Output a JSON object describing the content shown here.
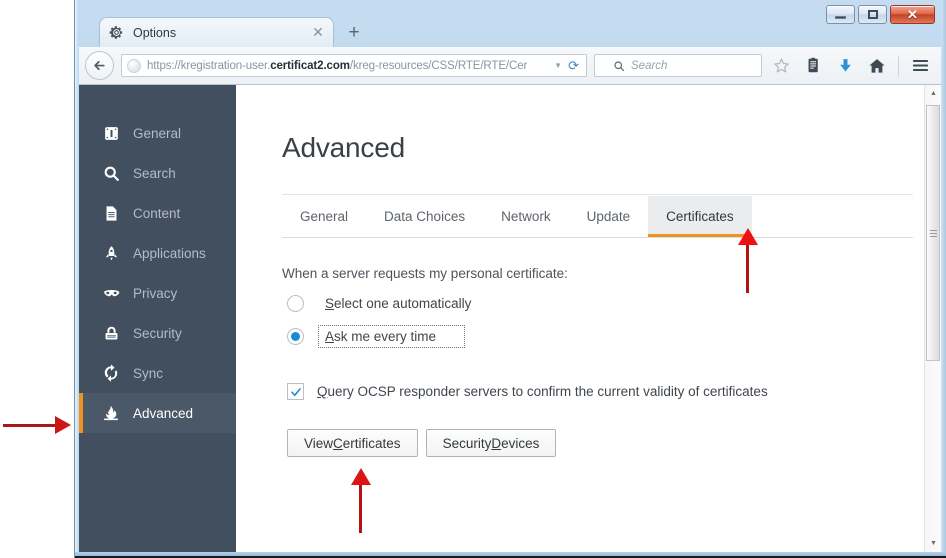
{
  "window": {
    "minimize_label": "Minimize",
    "maximize_label": "Maximize",
    "close_label": "✕"
  },
  "browser": {
    "tab": {
      "icon": "gear-icon",
      "title": "Options",
      "close_label": "✕"
    },
    "new_tab_label": "+",
    "back_label": "Back",
    "url": {
      "prefix": "https://kregistration-user.",
      "domain": "certificat2.com",
      "suffix": "/kreg-resources/CSS/RTE/RTE/Cer",
      "dropdown_icon": "chevron-down-icon",
      "reload_icon": "reload-icon"
    },
    "search": {
      "placeholder": "Search",
      "icon": "search-icon"
    },
    "toolbar_icons": [
      {
        "name": "bookmark-star-icon",
        "glyph": "star"
      },
      {
        "name": "library-icon",
        "glyph": "library"
      },
      {
        "name": "downloads-icon",
        "glyph": "download"
      },
      {
        "name": "home-icon",
        "glyph": "home"
      },
      {
        "name": "menu-hamburger-icon",
        "glyph": "menu"
      }
    ]
  },
  "sidebar": {
    "items": [
      {
        "label": "General",
        "icon": "general-icon",
        "active": false
      },
      {
        "label": "Search",
        "icon": "search-icon",
        "active": false
      },
      {
        "label": "Content",
        "icon": "content-icon",
        "active": false
      },
      {
        "label": "Applications",
        "icon": "applications-icon",
        "active": false
      },
      {
        "label": "Privacy",
        "icon": "privacy-mask-icon",
        "active": false
      },
      {
        "label": "Security",
        "icon": "security-lock-icon",
        "active": false
      },
      {
        "label": "Sync",
        "icon": "sync-icon",
        "active": false
      },
      {
        "label": "Advanced",
        "icon": "advanced-icon",
        "active": true
      }
    ]
  },
  "main": {
    "title": "Advanced",
    "tabs": [
      {
        "label": "General",
        "active": false
      },
      {
        "label": "Data Choices",
        "active": false
      },
      {
        "label": "Network",
        "active": false
      },
      {
        "label": "Update",
        "active": false
      },
      {
        "label": "Certificates",
        "active": true
      }
    ],
    "certificates": {
      "prompt": "When a server requests my personal certificate:",
      "radios": [
        {
          "accel": "S",
          "rest": "elect one automatically",
          "checked": false,
          "focused": false
        },
        {
          "accel": "A",
          "rest": "sk me every time",
          "checked": true,
          "focused": true
        }
      ],
      "checkbox": {
        "accel": "Q",
        "rest": "uery OCSP responder servers to confirm the current validity of certificates",
        "checked": true,
        "check_glyph": "✓"
      },
      "buttons": [
        {
          "pre": "View ",
          "accel": "C",
          "post": "ertificates"
        },
        {
          "pre": "Security ",
          "accel": "D",
          "post": "evices"
        }
      ]
    }
  },
  "colors": {
    "accent_orange": "#f0921f",
    "sidebar_bg": "#424f5e",
    "sidebar_active_bg": "#4b5867",
    "radio_blue": "#1a8cd0",
    "annotation_red": "#cc1717"
  }
}
